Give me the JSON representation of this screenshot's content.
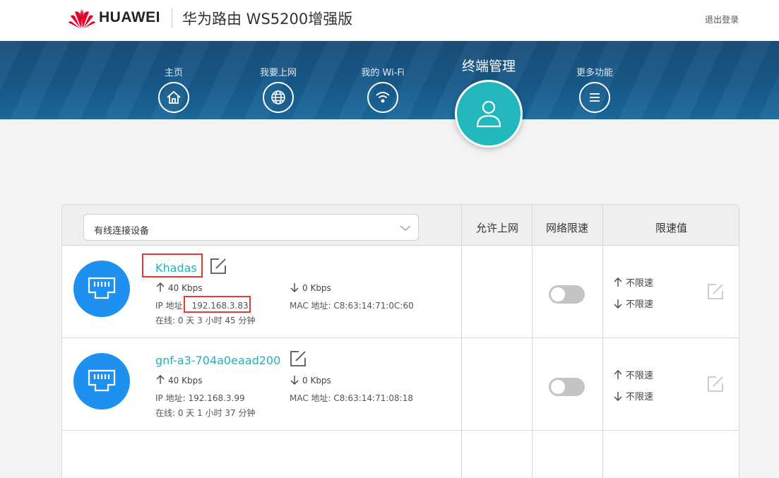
{
  "header": {
    "brand": "HUAWEI",
    "product_title": "华为路由 WS5200增强版",
    "logout_label": "退出登录"
  },
  "nav": {
    "items": [
      {
        "label": "主页",
        "icon": "home-icon"
      },
      {
        "label": "我要上网",
        "icon": "globe-icon"
      },
      {
        "label": "我的 Wi-Fi",
        "icon": "wifi-icon"
      },
      {
        "label": "更多功能",
        "icon": "menu-icon"
      }
    ],
    "active": {
      "label": "终端管理",
      "icon": "user-icon"
    }
  },
  "table": {
    "filter_select": "有线连接设备",
    "columns": [
      "允许上网",
      "网络限速",
      "限速值"
    ],
    "rows": [
      {
        "name": "Khadas",
        "upload": "40 Kbps",
        "download": "0 Kbps",
        "ip_label": "IP 地址:",
        "ip": "192.168.3.83",
        "mac": "MAC 地址: C8:63:14:71:0C:60",
        "online": "在线: 0 天 3 小时 45 分钟",
        "limit_up": "不限速",
        "limit_down": "不限速",
        "speed_limit_enabled": false
      },
      {
        "name": "gnf-a3-704a0eaad200",
        "upload": "40 Kbps",
        "download": "0 Kbps",
        "ip_label": "IP 地址:",
        "ip": "192.168.3.99",
        "mac": "MAC 地址: C8:63:14:71:08:18",
        "online": "在线: 0 天 1 小时 37 分钟",
        "limit_up": "不限速",
        "limit_down": "不限速",
        "speed_limit_enabled": false
      }
    ]
  },
  "colors": {
    "accent": "#23b8bd",
    "link": "#23b1b8",
    "device_icon": "#1e90f0",
    "highlight": "#e53935",
    "nav_bg": "#175a8b"
  }
}
